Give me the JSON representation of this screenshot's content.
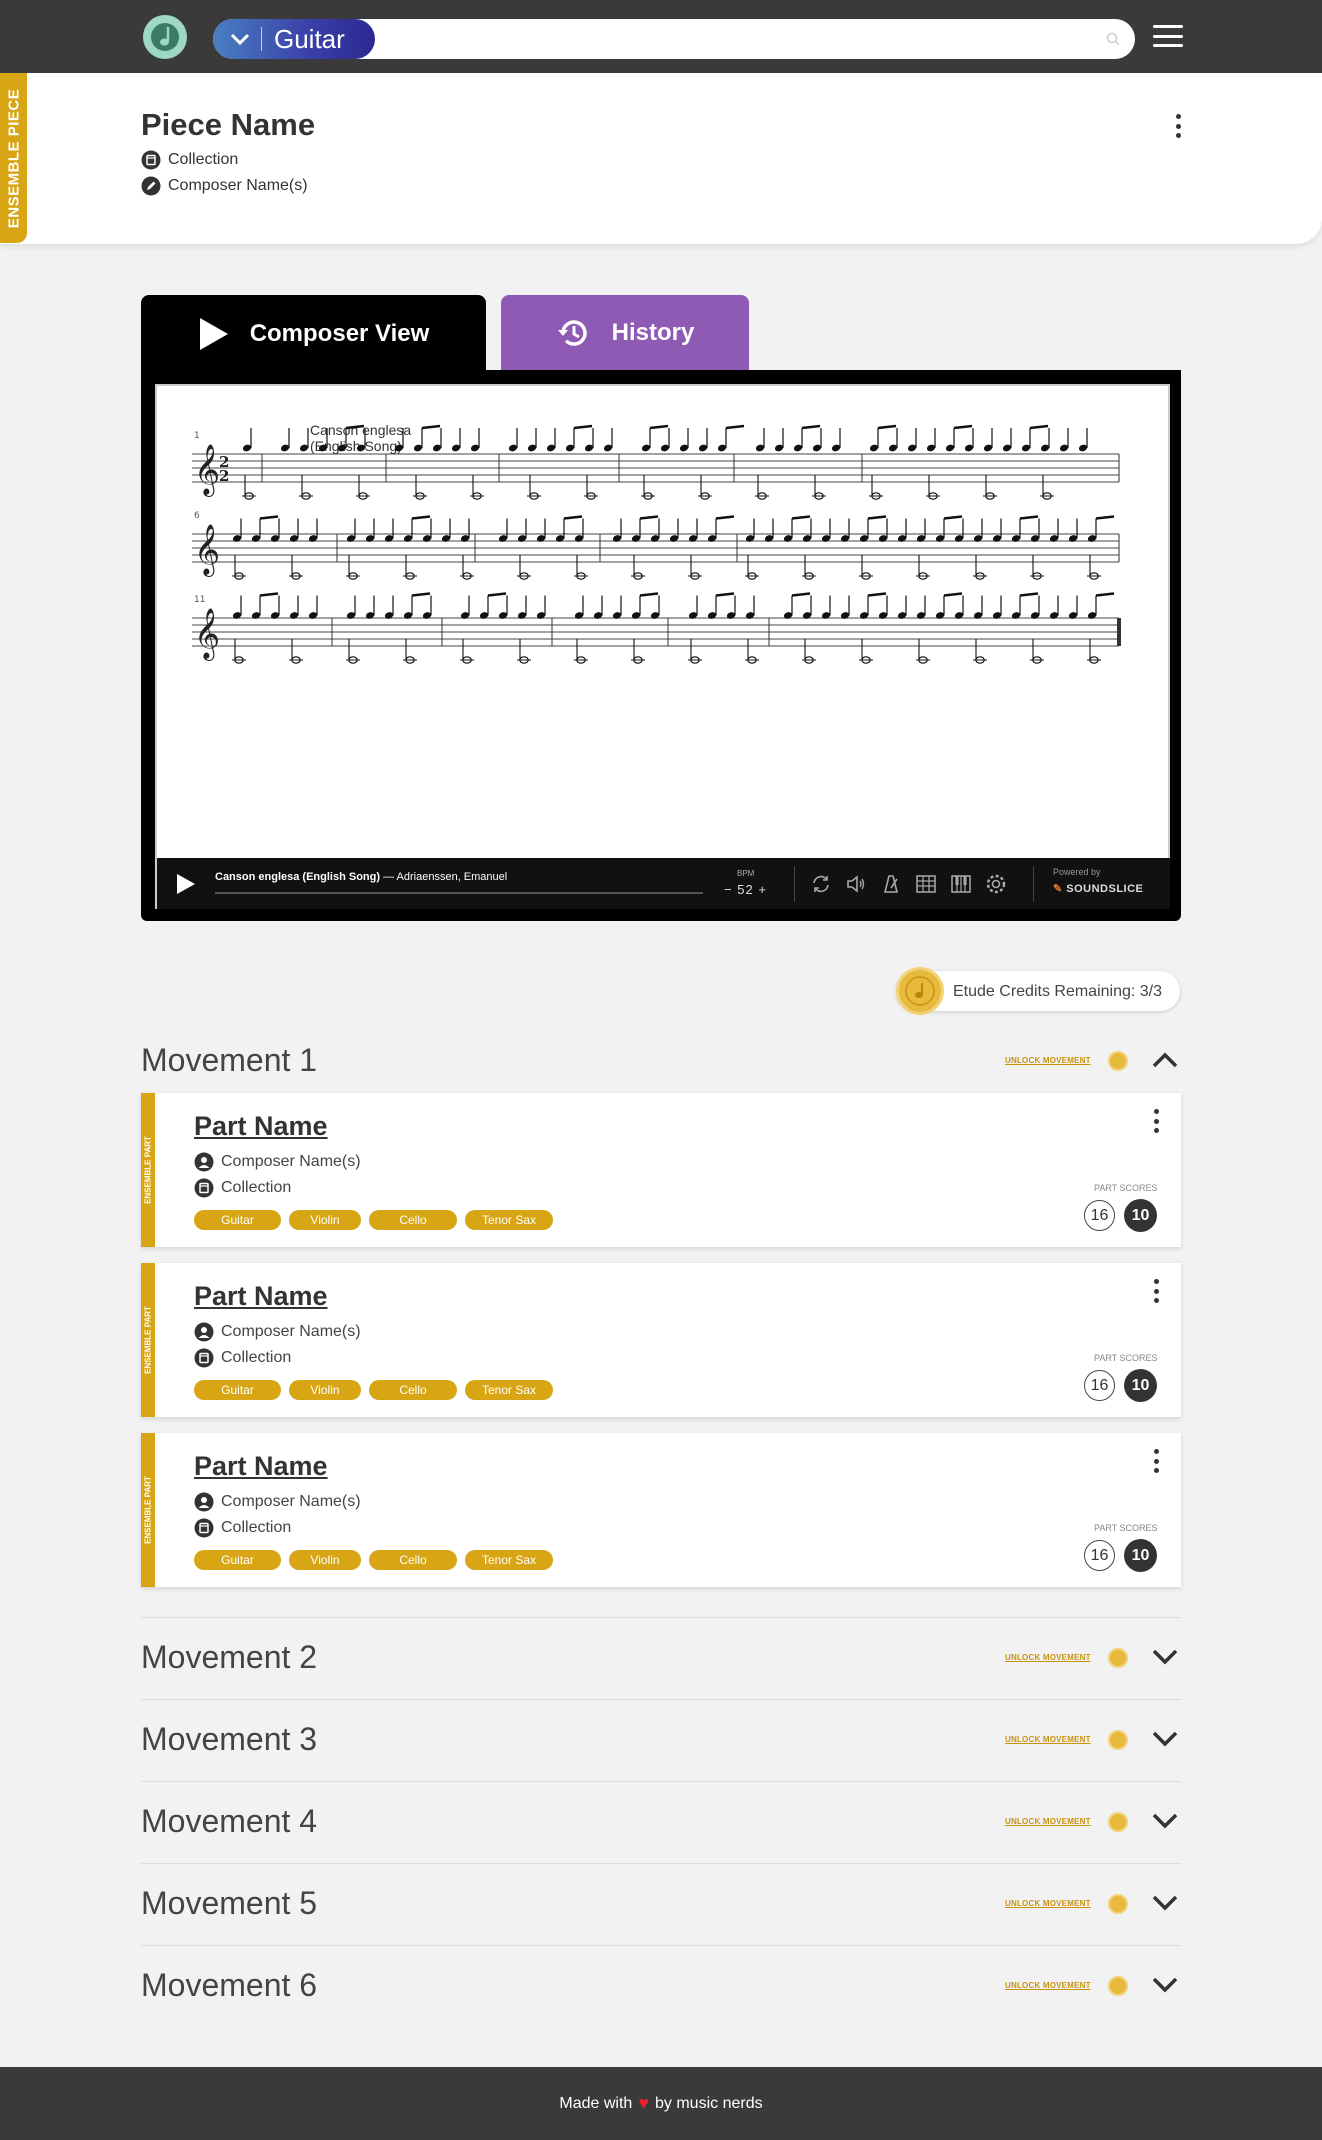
{
  "header": {
    "instrument": "Guitar"
  },
  "piece": {
    "badge": "ENSEMBLE PIECE",
    "title": "Piece Name",
    "collection": "Collection",
    "composer": "Composer Name(s)"
  },
  "tabs": [
    {
      "label": "Composer View",
      "active": true
    },
    {
      "label": "History",
      "active": false
    }
  ],
  "score": {
    "title_line1": "Canson englesa",
    "title_line2": "(English Song)",
    "measure_numbers": [
      "1",
      "6",
      "11"
    ],
    "player": {
      "track_title": "Canson englesa (English Song)",
      "track_composer": "— Adriaenssen, Emanuel",
      "bpm_label": "BPM",
      "bpm_value": "52",
      "bpm_minus": "−",
      "bpm_plus": "+",
      "powered_by": "Powered by",
      "brand": "SOUNDSLICE"
    }
  },
  "credits": {
    "text": "Etude Credits Remaining: 3/3"
  },
  "movements": [
    {
      "title": "Movement 1",
      "unlock_label": "UNLOCK MOVEMENT",
      "expanded": true,
      "parts": [
        {
          "strip": "ENSEMBLE PART",
          "name": "Part Name",
          "composer": "Composer Name(s)",
          "collection": "Collection",
          "instruments": [
            "Guitar",
            "Violin",
            "Cello",
            "Tenor Sax"
          ],
          "scores_label": "PART SCORES",
          "score_a": "16",
          "score_b": "10"
        },
        {
          "strip": "ENSEMBLE PART",
          "name": "Part Name",
          "composer": "Composer Name(s)",
          "collection": "Collection",
          "instruments": [
            "Guitar",
            "Violin",
            "Cello",
            "Tenor Sax"
          ],
          "scores_label": "PART SCORES",
          "score_a": "16",
          "score_b": "10"
        },
        {
          "strip": "ENSEMBLE PART",
          "name": "Part Name",
          "composer": "Composer Name(s)",
          "collection": "Collection",
          "instruments": [
            "Guitar",
            "Violin",
            "Cello",
            "Tenor Sax"
          ],
          "scores_label": "PART SCORES",
          "score_a": "16",
          "score_b": "10"
        }
      ]
    },
    {
      "title": "Movement 2",
      "unlock_label": "UNLOCK MOVEMENT",
      "expanded": false
    },
    {
      "title": "Movement 3",
      "unlock_label": "UNLOCK MOVEMENT",
      "expanded": false
    },
    {
      "title": "Movement 4",
      "unlock_label": "UNLOCK MOVEMENT",
      "expanded": false
    },
    {
      "title": "Movement 5",
      "unlock_label": "UNLOCK MOVEMENT",
      "expanded": false
    },
    {
      "title": "Movement 6",
      "unlock_label": "UNLOCK MOVEMENT",
      "expanded": false
    }
  ],
  "footer": {
    "before": "Made with",
    "after": "by music nerds"
  },
  "colors": {
    "ensemble_gold": "#d8a514",
    "history_purple": "#8e5ab3",
    "topbar": "#3a3a3a"
  }
}
